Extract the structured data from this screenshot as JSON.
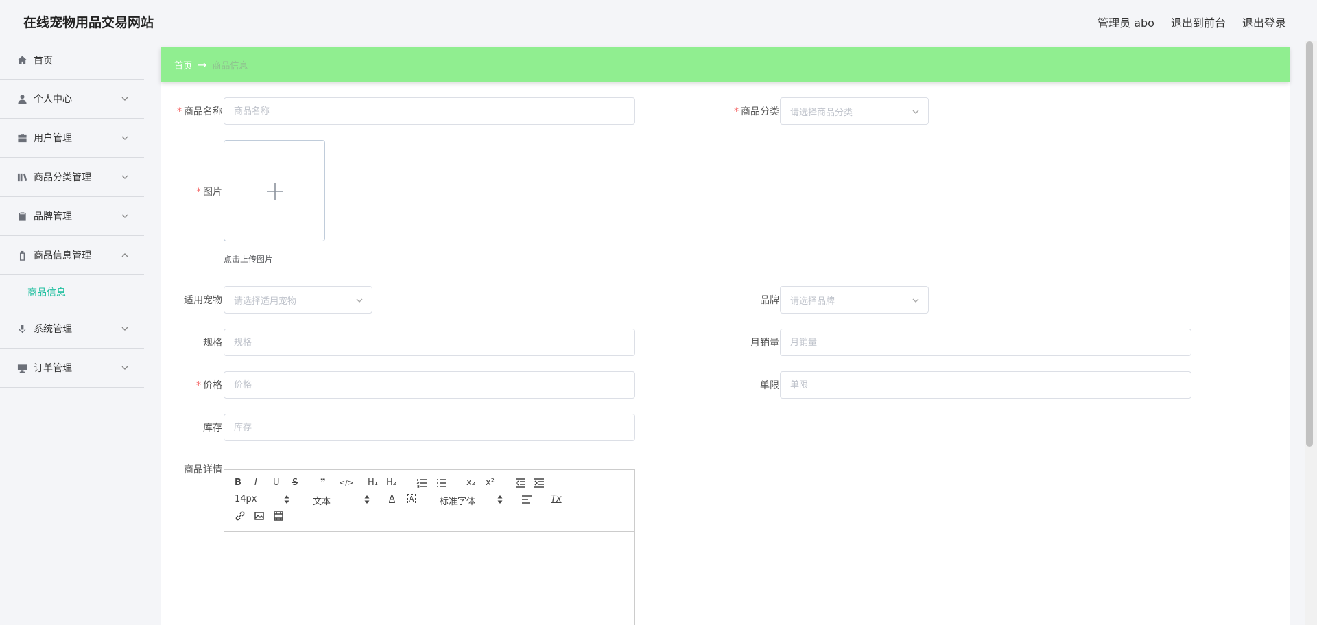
{
  "header": {
    "site_title": "在线宠物用品交易网站",
    "admin_label": "管理员 abo",
    "to_frontend": "退出到前台",
    "logout": "退出登录"
  },
  "sidebar": {
    "items": [
      {
        "label": "首页",
        "icon": "home-icon"
      },
      {
        "label": "个人中心",
        "icon": "user-icon"
      },
      {
        "label": "用户管理",
        "icon": "briefcase-icon"
      },
      {
        "label": "商品分类管理",
        "icon": "books-icon"
      },
      {
        "label": "品牌管理",
        "icon": "clipboard-icon"
      },
      {
        "label": "商品信息管理",
        "icon": "bottle-icon"
      },
      {
        "label": "系统管理",
        "icon": "microphone-icon"
      },
      {
        "label": "订单管理",
        "icon": "monitor-icon"
      }
    ],
    "submenu_active": "商品信息"
  },
  "breadcrumb": {
    "home": "首页",
    "separator": "→",
    "current": "商品信息"
  },
  "form": {
    "name_label": "商品名称",
    "name_placeholder": "商品名称",
    "category_label": "商品分类",
    "category_placeholder": "请选择商品分类",
    "image_label": "图片",
    "upload_tip": "点击上传图片",
    "pet_label": "适用宠物",
    "pet_placeholder": "请选择适用宠物",
    "brand_label": "品牌",
    "brand_placeholder": "请选择品牌",
    "spec_label": "规格",
    "spec_placeholder": "规格",
    "monthly_sales_label": "月销量",
    "monthly_sales_placeholder": "月销量",
    "price_label": "价格",
    "price_placeholder": "价格",
    "limit_label": "单限",
    "limit_placeholder": "单限",
    "stock_label": "库存",
    "stock_placeholder": "库存",
    "detail_label": "商品详情",
    "required_mark": "*"
  },
  "editor": {
    "bold": "B",
    "italic": "I",
    "underline": "U",
    "strike": "S",
    "quote": "❞",
    "code": "</>",
    "h1": "H₁",
    "h2": "H₂",
    "sub": "x₂",
    "sup": "x²",
    "font_size": "14px",
    "block_type": "文本",
    "font_family": "标准字体",
    "clear_format": "Tx"
  },
  "colors": {
    "breadcrumb_bg": "#90ee90",
    "submenu_active": "#1fbf9f",
    "required": "#f56c6c"
  }
}
